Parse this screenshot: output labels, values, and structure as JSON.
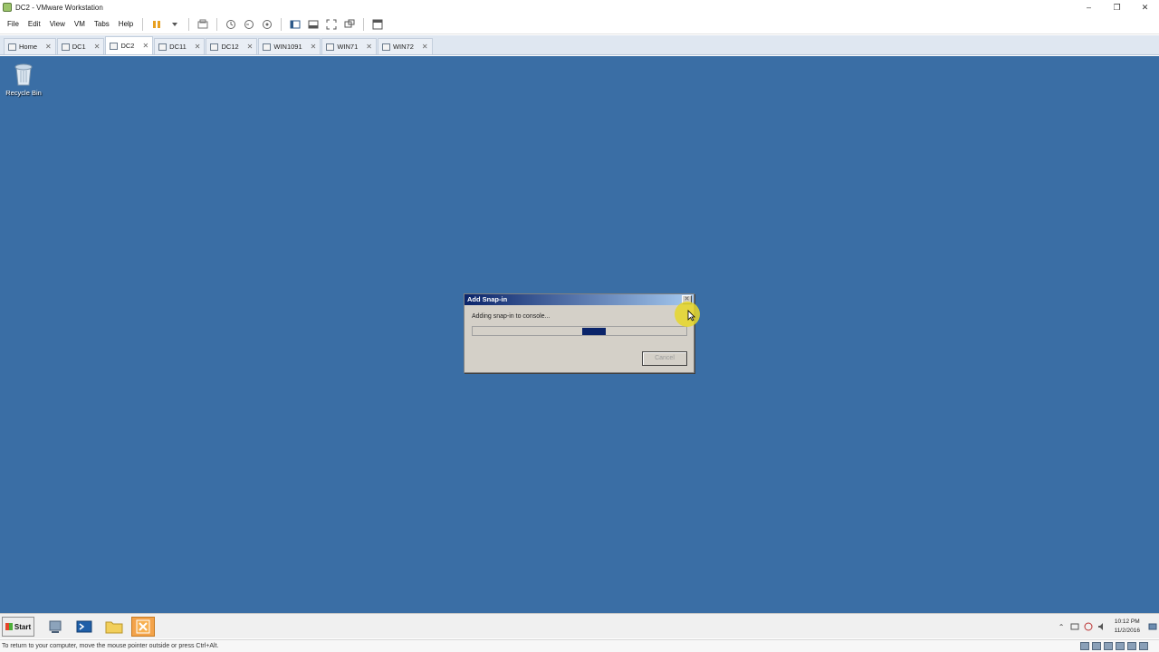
{
  "window": {
    "title": "DC2 - VMware Workstation"
  },
  "menu": {
    "items": [
      "File",
      "Edit",
      "View",
      "VM",
      "Tabs",
      "Help"
    ]
  },
  "tabs": [
    {
      "label": "Home"
    },
    {
      "label": "DC1"
    },
    {
      "label": "DC2",
      "active": true
    },
    {
      "label": "DC11"
    },
    {
      "label": "DC12"
    },
    {
      "label": "WIN1091"
    },
    {
      "label": "WIN71"
    },
    {
      "label": "WIN72"
    }
  ],
  "desktop": {
    "background_color": "#3a6ea5",
    "icons": [
      {
        "label": "Recycle Bin",
        "icon": "recycle-bin-icon"
      }
    ]
  },
  "dialog": {
    "title": "Add Snap-in",
    "message": "Adding snap-in to console...",
    "cancel_label": "Cancel",
    "progress_state": "indeterminate"
  },
  "taskbar": {
    "start_label": "Start",
    "clock_time": "10:12 PM",
    "clock_date": "11/2/2016"
  },
  "statusbar": {
    "text": "To return to your computer, move the mouse pointer outside or press Ctrl+Alt."
  }
}
